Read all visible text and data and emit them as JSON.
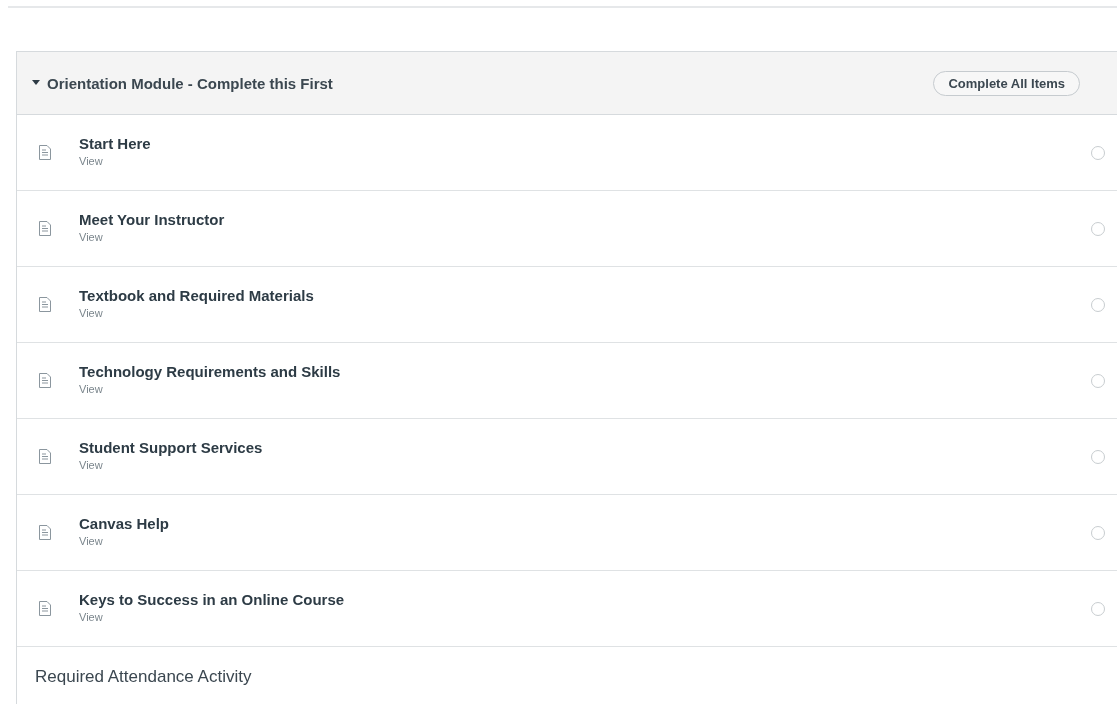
{
  "module": {
    "title": "Orientation Module - Complete this First",
    "expanded": true,
    "complete_all_button": "Complete All Items",
    "items": [
      {
        "title": "Start Here",
        "action": "View",
        "completed": false
      },
      {
        "title": "Meet Your Instructor",
        "action": "View",
        "completed": false
      },
      {
        "title": "Textbook and Required Materials",
        "action": "View",
        "completed": false
      },
      {
        "title": "Technology Requirements and Skills",
        "action": "View",
        "completed": false
      },
      {
        "title": "Student Support Services",
        "action": "View",
        "completed": false
      },
      {
        "title": "Canvas Help",
        "action": "View",
        "completed": false
      },
      {
        "title": "Keys to Success in an Online Course",
        "action": "View",
        "completed": false
      }
    ]
  },
  "subheader": "Required Attendance Activity"
}
